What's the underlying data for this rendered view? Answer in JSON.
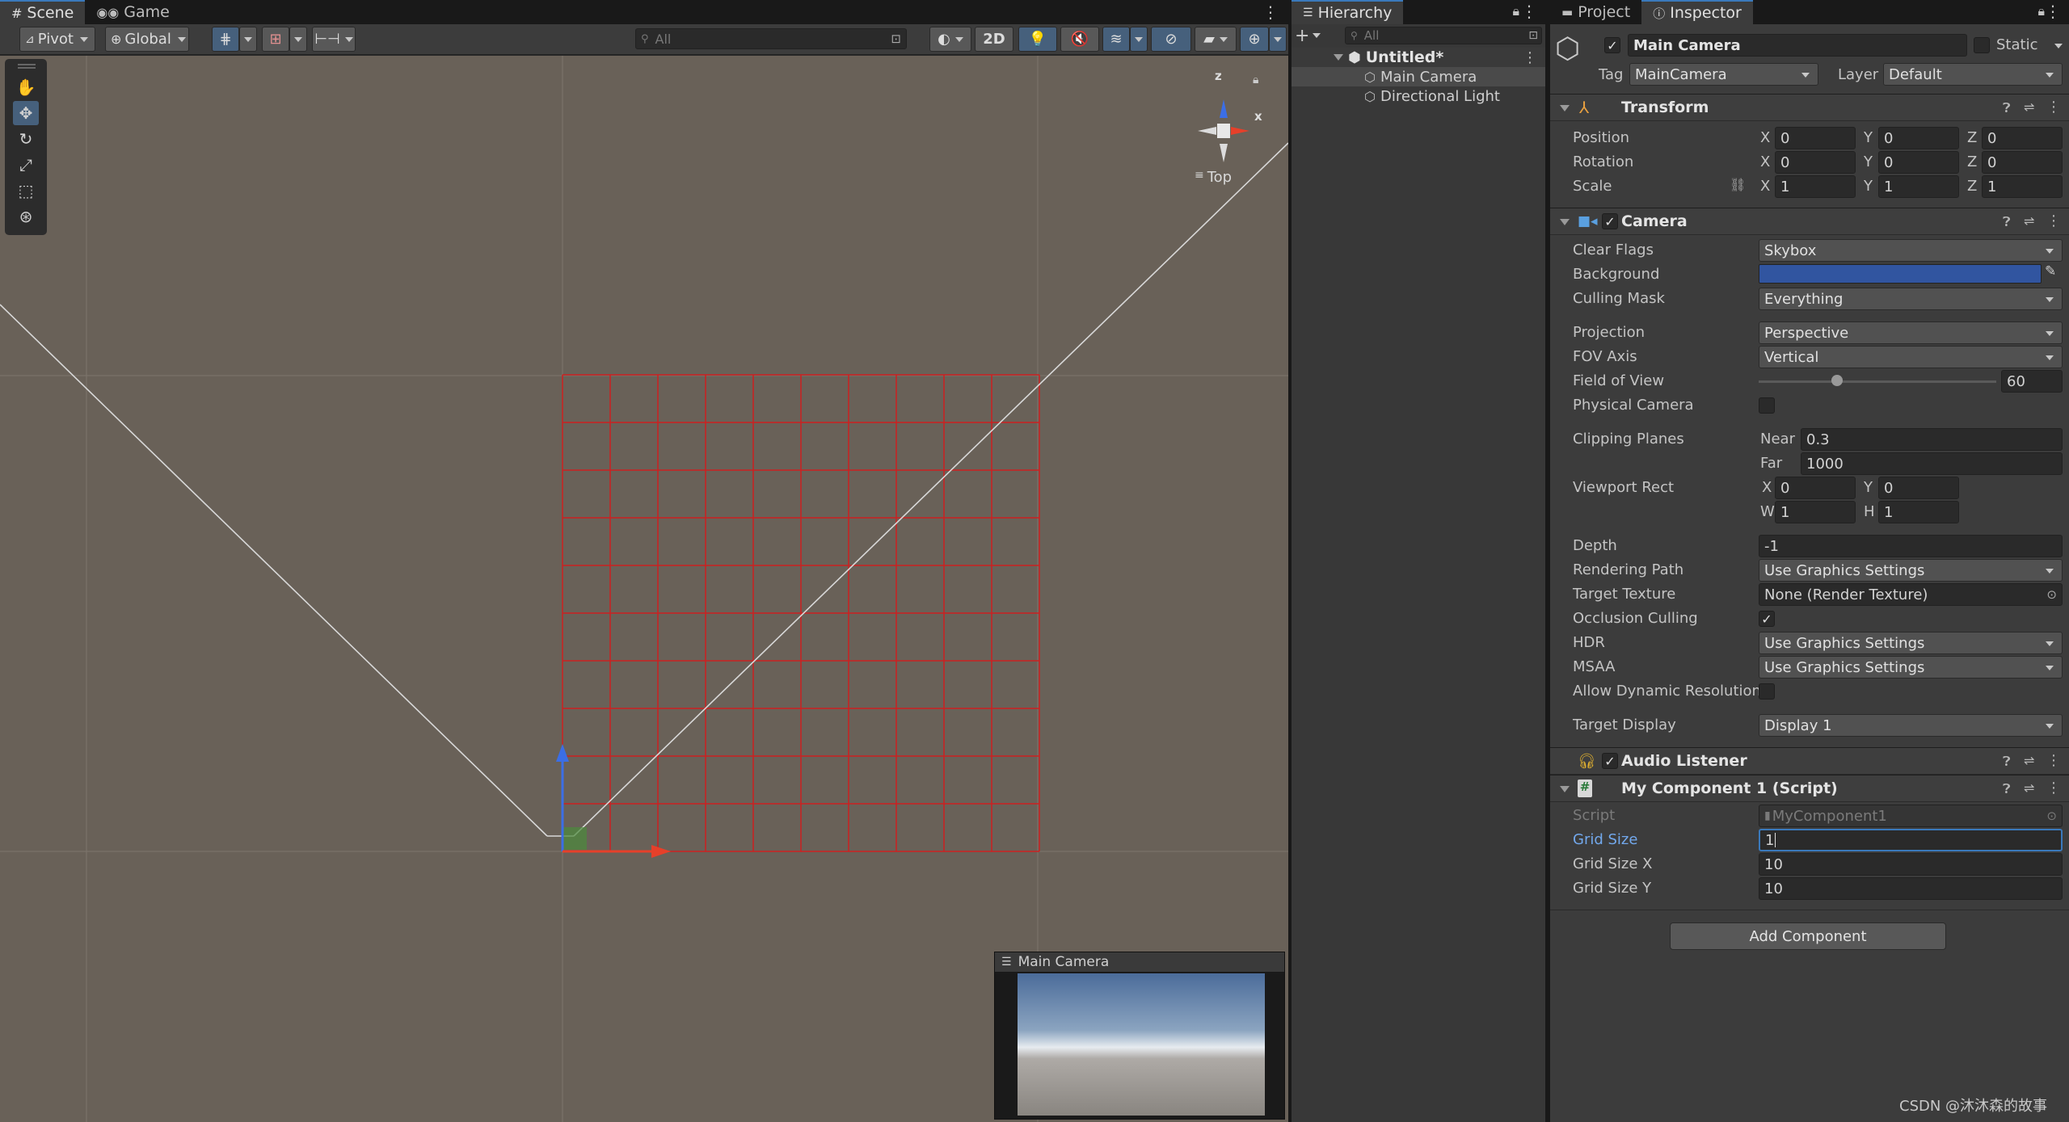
{
  "scene_tabs": {
    "scene": "Scene",
    "game": "Game"
  },
  "scene_toolbar": {
    "pivot": "Pivot",
    "global": "Global",
    "search_placeholder": "All",
    "mode_2d": "2D"
  },
  "gizmo": {
    "z": "z",
    "x": "x",
    "view": "Top"
  },
  "camera_preview": {
    "title": "Main Camera"
  },
  "grid": {
    "size_x": 10,
    "size_y": 10,
    "color": "#cc2020"
  },
  "hierarchy": {
    "tab": "Hierarchy",
    "search_placeholder": "All",
    "scene": "Untitled*",
    "items": [
      "Main Camera",
      "Directional Light"
    ]
  },
  "inspector_tabs": {
    "project": "Project",
    "inspector": "Inspector"
  },
  "object": {
    "name": "Main Camera",
    "static": "Static",
    "tag_label": "Tag",
    "tag": "MainCamera",
    "layer_label": "Layer",
    "layer": "Default"
  },
  "transform": {
    "title": "Transform",
    "rows": [
      {
        "label": "Position",
        "x": "0",
        "y": "0",
        "z": "0"
      },
      {
        "label": "Rotation",
        "x": "0",
        "y": "0",
        "z": "0"
      },
      {
        "label": "Scale",
        "x": "1",
        "y": "1",
        "z": "1"
      }
    ],
    "axis_x": "X",
    "axis_y": "Y",
    "axis_z": "Z"
  },
  "camera": {
    "title": "Camera",
    "clear_flags_label": "Clear Flags",
    "clear_flags": "Skybox",
    "background_label": "Background",
    "background_color": "#3155a0",
    "culling_mask_label": "Culling Mask",
    "culling_mask": "Everything",
    "projection_label": "Projection",
    "projection": "Perspective",
    "fov_axis_label": "FOV Axis",
    "fov_axis": "Vertical",
    "fov_label": "Field of View",
    "fov": "60",
    "fov_min": 1,
    "fov_max": 179,
    "physical_label": "Physical Camera",
    "clipping_label": "Clipping Planes",
    "near_label": "Near",
    "near": "0.3",
    "far_label": "Far",
    "far": "1000",
    "viewport_label": "Viewport Rect",
    "vx_label": "X",
    "vx": "0",
    "vy_label": "Y",
    "vy": "0",
    "vw_label": "W",
    "vw": "1",
    "vh_label": "H",
    "vh": "1",
    "depth_label": "Depth",
    "depth": "-1",
    "rendering_path_label": "Rendering Path",
    "rendering_path": "Use Graphics Settings",
    "target_texture_label": "Target Texture",
    "target_texture": "None (Render Texture)",
    "occlusion_label": "Occlusion Culling",
    "occlusion_check": "✓",
    "hdr_label": "HDR",
    "hdr": "Use Graphics Settings",
    "msaa_label": "MSAA",
    "msaa": "Use Graphics Settings",
    "dynres_label": "Allow Dynamic Resolution",
    "target_display_label": "Target Display",
    "target_display": "Display 1"
  },
  "audio_listener": {
    "title": "Audio Listener"
  },
  "my_component": {
    "title": "My Component 1 (Script)",
    "script_label": "Script",
    "script": "MyComponent1",
    "grid_size_label": "Grid Size",
    "grid_size": "1",
    "grid_size_x_label": "Grid Size X",
    "grid_size_x": "10",
    "grid_size_y_label": "Grid Size Y",
    "grid_size_y": "10"
  },
  "add_component": "Add Component",
  "watermark": "CSDN @沐沐森的故事"
}
